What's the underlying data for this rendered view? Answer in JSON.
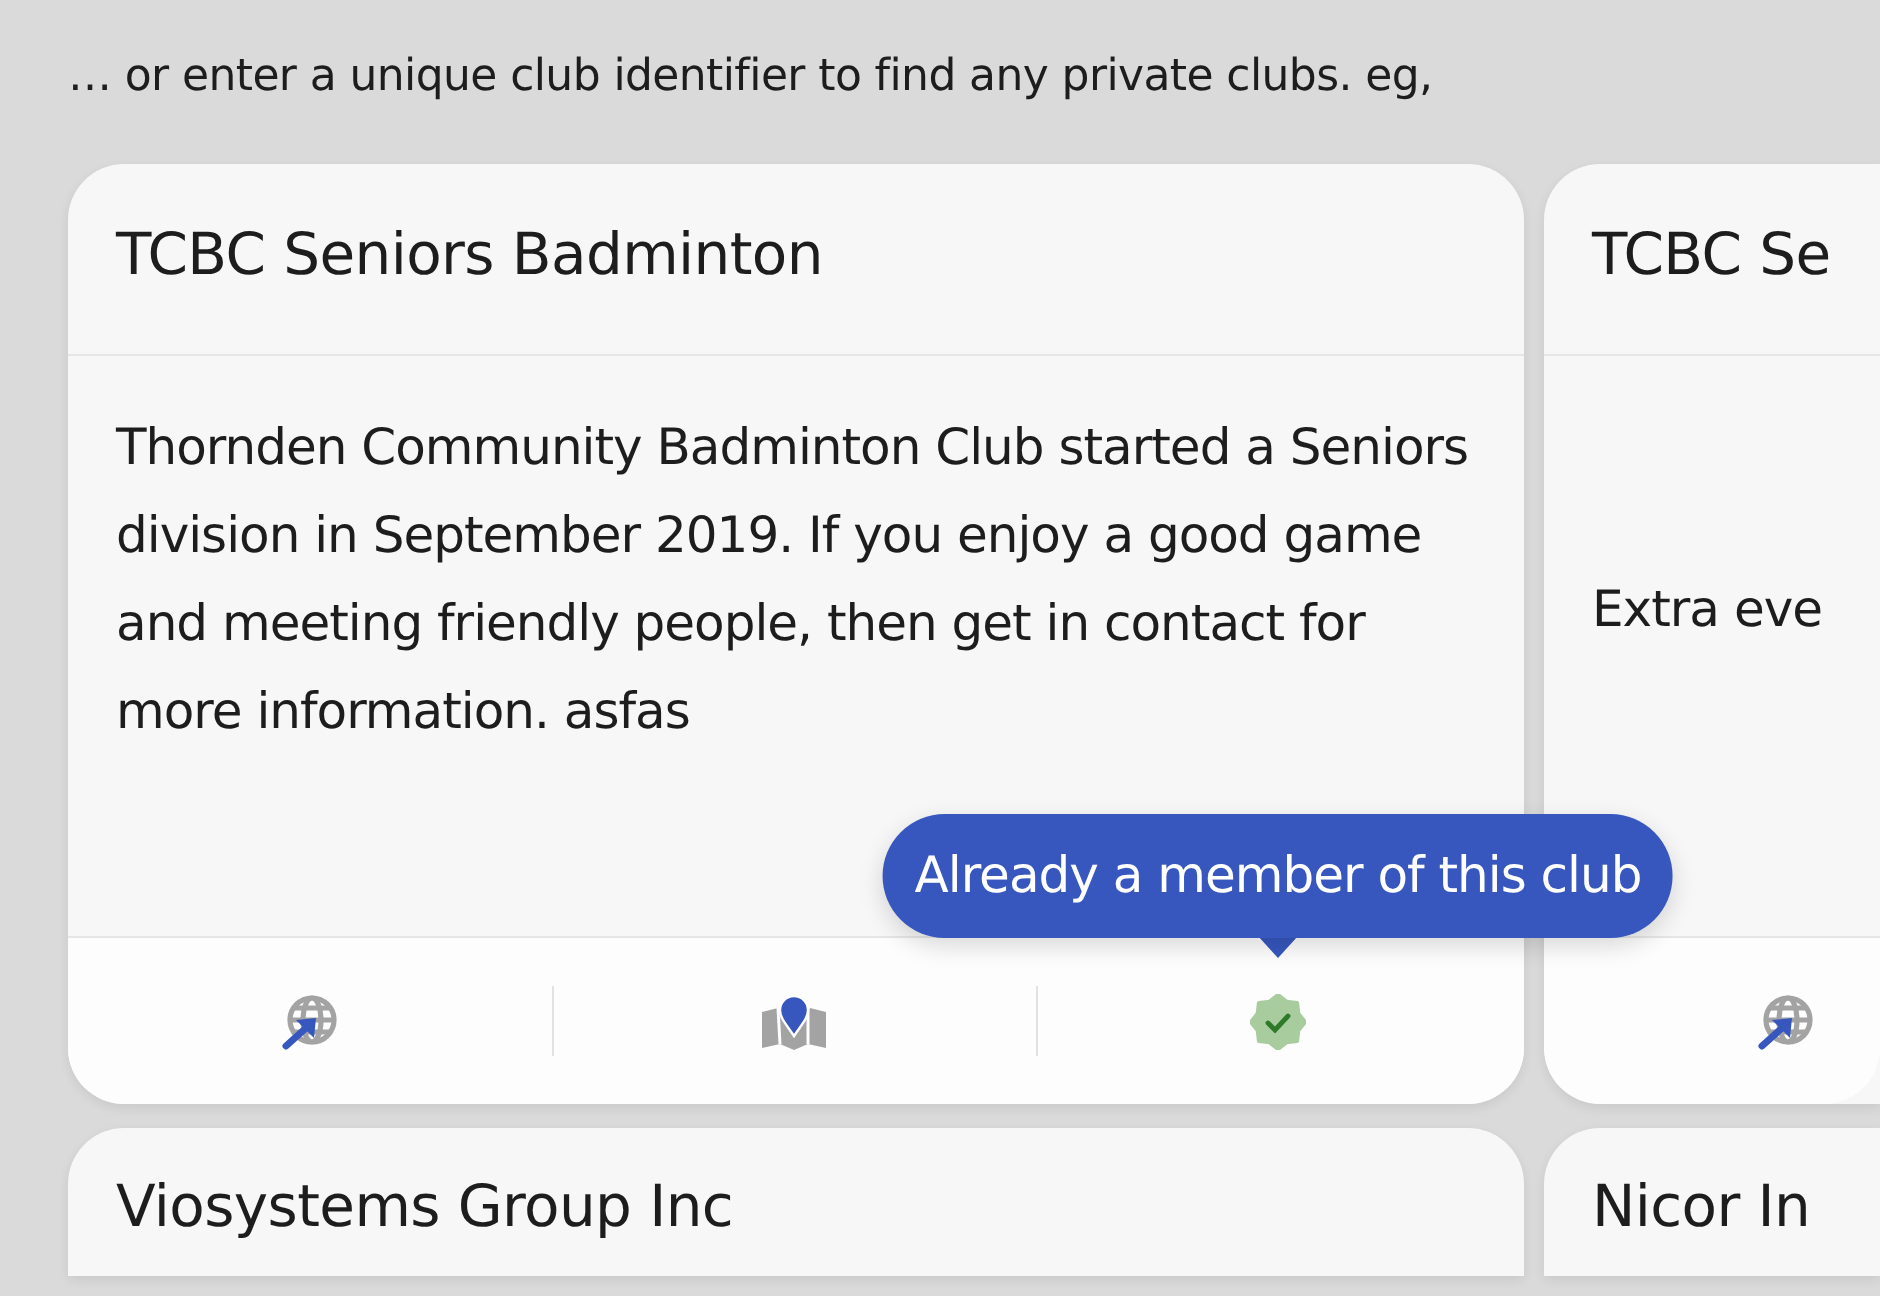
{
  "intro": "… or enter a unique club identifier to find any private clubs. eg,",
  "clubs": [
    {
      "title": "TCBC Seniors Badminton",
      "description": "Thornden Community Badminton Club started a Seniors division in September 2019. If you enjoy a good game and meeting friendly people, then get in contact for more information. asfas",
      "actions": [
        {
          "kind": "website"
        },
        {
          "kind": "map"
        },
        {
          "kind": "membership",
          "member": true,
          "tooltip": "Already a member of this club"
        }
      ]
    },
    {
      "title": "TCBC Se",
      "description": "Extra eve",
      "actions": [
        {
          "kind": "website"
        }
      ]
    },
    {
      "title": "Viosystems Group Inc"
    },
    {
      "title": "Nicor In"
    }
  ]
}
